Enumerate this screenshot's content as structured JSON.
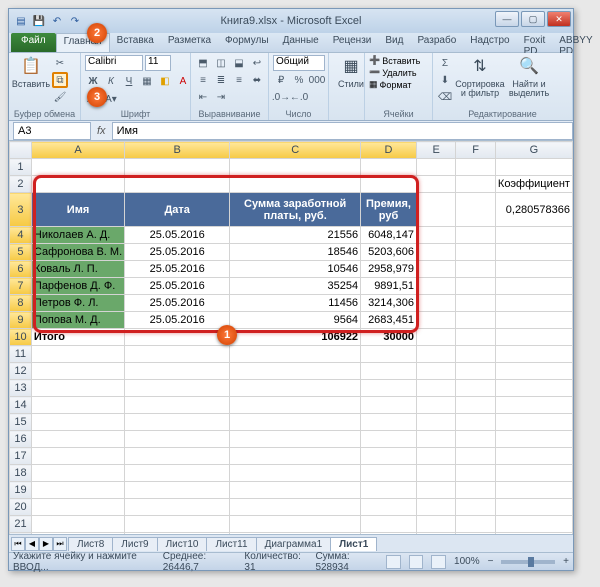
{
  "title": "Книга9.xlsx - Microsoft Excel",
  "tabs": {
    "file": "Файл",
    "list": [
      "Главная",
      "Вставка",
      "Разметка",
      "Формулы",
      "Данные",
      "Рецензи",
      "Вид",
      "Разрабо",
      "Надстро",
      "Foxit PD",
      "ABBYY PD"
    ],
    "active": "Главная"
  },
  "ribbon": {
    "clipboard": {
      "paste": "Вставить",
      "label": "Буфер обмена"
    },
    "font": {
      "name": "Calibri",
      "size": "11",
      "label": "Шрифт"
    },
    "align": {
      "label": "Выравнивание"
    },
    "number": {
      "format": "Общий",
      "label": "Число"
    },
    "styles": {
      "btn": "Стили",
      "label": ""
    },
    "cells": {
      "insert": "Вставить",
      "delete": "Удалить",
      "format": "Формат",
      "label": "Ячейки"
    },
    "edit": {
      "sort": "Сортировка и фильтр",
      "find": "Найти и выделить",
      "label": "Редактирование"
    }
  },
  "namebox": "A3",
  "formula": "Имя",
  "columns": [
    "A",
    "B",
    "C",
    "D",
    "E",
    "F",
    "G"
  ],
  "table": {
    "headers": {
      "name": "Имя",
      "date": "Дата",
      "sum": "Сумма заработной платы, руб.",
      "bonus": "Премия, руб"
    },
    "rows": [
      {
        "name": "Николаев А. Д.",
        "date": "25.05.2016",
        "sum": "21556",
        "bonus": "6048,147"
      },
      {
        "name": "Сафронова В. М.",
        "date": "25.05.2016",
        "sum": "18546",
        "bonus": "5203,606"
      },
      {
        "name": "Коваль Л. П.",
        "date": "25.05.2016",
        "sum": "10546",
        "bonus": "2958,979"
      },
      {
        "name": "Парфенов Д. Ф.",
        "date": "25.05.2016",
        "sum": "35254",
        "bonus": "9891,51"
      },
      {
        "name": "Петров Ф. Л.",
        "date": "25.05.2016",
        "sum": "11456",
        "bonus": "3214,306"
      },
      {
        "name": "Попова М. Д.",
        "date": "25.05.2016",
        "sum": "9564",
        "bonus": "2683,451"
      }
    ],
    "total": {
      "label": "Итого",
      "sum": "106922",
      "bonus": "30000"
    }
  },
  "side": {
    "koef_label": "Коэффициент",
    "koef_value": "0,280578366"
  },
  "sheets": [
    "Лист8",
    "Лист9",
    "Лист10",
    "Лист11",
    "Диаграмма1",
    "Лист1"
  ],
  "active_sheet": "Лист1",
  "status": {
    "left": "Укажите ячейку и нажмите ВВОД...",
    "avg_l": "Среднее:",
    "avg_v": "26446,7",
    "cnt_l": "Количество:",
    "cnt_v": "31",
    "sum_l": "Сумма:",
    "sum_v": "528934",
    "zoom": "100%"
  },
  "markers": {
    "m1": "1",
    "m2": "2",
    "m3": "3"
  }
}
